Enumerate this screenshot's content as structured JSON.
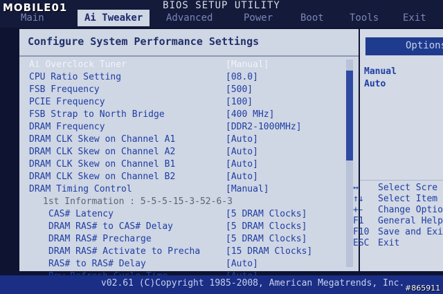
{
  "watermark": {
    "text": "MOBILE01",
    "tag": "#865911"
  },
  "bios": {
    "title": "BIOS SETUP UTILITY",
    "tabs": [
      "Main",
      "Ai Tweaker",
      "Advanced",
      "Power",
      "Boot",
      "Tools",
      "Exit"
    ],
    "active_tab": "Ai Tweaker"
  },
  "panel": {
    "title": "Configure System Performance Settings",
    "rows": [
      {
        "label": "Ai Overclock Tuner",
        "value": "[Manual]"
      },
      {
        "label": "CPU Ratio Setting",
        "value": "[08.0]"
      },
      {
        "label": "FSB Frequency",
        "value": "[500]"
      },
      {
        "label": "PCIE Frequency",
        "value": "[100]"
      },
      {
        "label": "FSB Strap to North Bridge",
        "value": "[400 MHz]"
      },
      {
        "label": "DRAM Frequency",
        "value": "[DDR2-1000MHz]"
      },
      {
        "label": "DRAM CLK Skew on Channel A1",
        "value": "[Auto]"
      },
      {
        "label": "DRAM CLK Skew on Channel A2",
        "value": "[Auto]"
      },
      {
        "label": "DRAM CLK Skew on Channel B1",
        "value": "[Auto]"
      },
      {
        "label": "DRAM CLK Skew on Channel B2",
        "value": "[Auto]"
      },
      {
        "label": "DRAM Timing Control",
        "value": "[Manual]"
      },
      {
        "label": "1st Information : 5-5-5-15-3-52-6-3",
        "value": ""
      },
      {
        "label": "CAS# Latency",
        "value": "[5 DRAM Clocks]"
      },
      {
        "label": "DRAM RAS# to CAS# Delay",
        "value": "[5 DRAM Clocks]"
      },
      {
        "label": "DRAM RAS# Precharge",
        "value": "[5 DRAM Clocks]"
      },
      {
        "label": "DRAM RAS# Activate to Precha",
        "value": "[15 DRAM Clocks]"
      },
      {
        "label": "RAS# to RAS# Delay",
        "value": "[Auto]"
      },
      {
        "label": "Row Refresh Cycle Time",
        "value": "[Auto]"
      }
    ]
  },
  "options": {
    "title": "Options",
    "items": [
      "Manual",
      "Auto"
    ]
  },
  "help": [
    {
      "key": "↔",
      "text": "Select Scre"
    },
    {
      "key": "↑↓",
      "text": "Select Item"
    },
    {
      "key": "+-",
      "text": "Change Optio"
    },
    {
      "key": "F1",
      "text": "General Help"
    },
    {
      "key": "F10",
      "text": "Save and Exi"
    },
    {
      "key": "ESC",
      "text": "Exit"
    }
  ],
  "footer": "v02.61 (C)Copyright 1985-2008, American Megatrends, Inc.",
  "colors": {
    "accent": "#1e3ea3",
    "panel": "#cfd6e4",
    "bar": "#1a2e86"
  }
}
